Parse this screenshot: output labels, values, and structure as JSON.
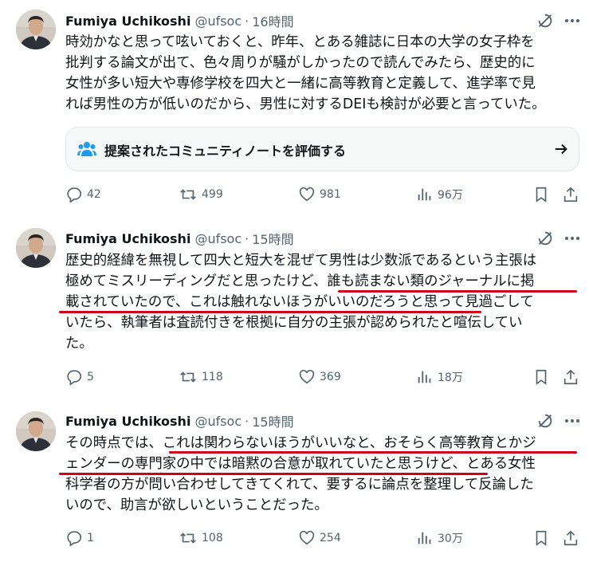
{
  "colors": {
    "text": "#0f1419",
    "muted": "#536471",
    "underline": "#d0021b",
    "note_box_bg": "#f7f9f9",
    "note_icon": "#1d9bf0"
  },
  "tweets": [
    {
      "author": {
        "name": "Fumiya Uchikoshi",
        "handle": "@ufsoc",
        "time": "16時間"
      },
      "lines": [
        "時効かなと思って呟いておくと、昨年、とある雑誌に日本の大学の女子枠を",
        "批判する論文が出て、色々周りが騒がしかったので読んでみたら、歴史的に",
        "女性が多い短大や専修学校を四大と一緒に高等教育と定義して、進学率で見",
        "れば男性の方が低いのだから、男性に対するDEIも検討が必要と言っていた。"
      ],
      "community_note": {
        "label": "提案されたコミュニティノートを評価する",
        "icon": "people-icon",
        "arrow": "arrow-right-icon"
      },
      "stats": {
        "replies": "42",
        "reposts": "499",
        "likes": "981",
        "views": "96万"
      }
    },
    {
      "author": {
        "name": "Fumiya Uchikoshi",
        "handle": "@ufsoc",
        "time": "15時間"
      },
      "lines": [
        "歴史的経緯を無視して四大と短大を混ぜて男性は少数派であるという主張は",
        "極めてミスリーディングだと思ったけど、誰も読まない類のジャーナルに掲",
        "載されていたので、これは触れないほうがいいのだろうと思って見過ごして",
        "いたら、執筆者は査読付きを根拠に自分の主張が認められたと喧伝してい",
        "た。"
      ],
      "stats": {
        "replies": "5",
        "reposts": "118",
        "likes": "369",
        "views": "18万"
      }
    },
    {
      "author": {
        "name": "Fumiya Uchikoshi",
        "handle": "@ufsoc",
        "time": "15時間"
      },
      "lines": [
        "その時点では、これは関わらないほうがいいなと、おそらく高等教育とかジ",
        "ェンダーの専門家の中では暗黙の合意が取れていたと思うけど、とある女性",
        "科学者の方が問い合わせしてきてくれて、要するに論点を整理して反論した",
        "いので、助言が欲しいということだった。"
      ],
      "stats": {
        "replies": "1",
        "reposts": "108",
        "likes": "254",
        "views": "30万"
      }
    }
  ],
  "icons": {
    "reply": "reply-icon",
    "repost": "repost-icon",
    "like": "heart-icon",
    "views": "views-icon",
    "bookmark": "bookmark-icon",
    "share": "share-icon",
    "grok": "grok-icon",
    "more": "more-icon"
  }
}
